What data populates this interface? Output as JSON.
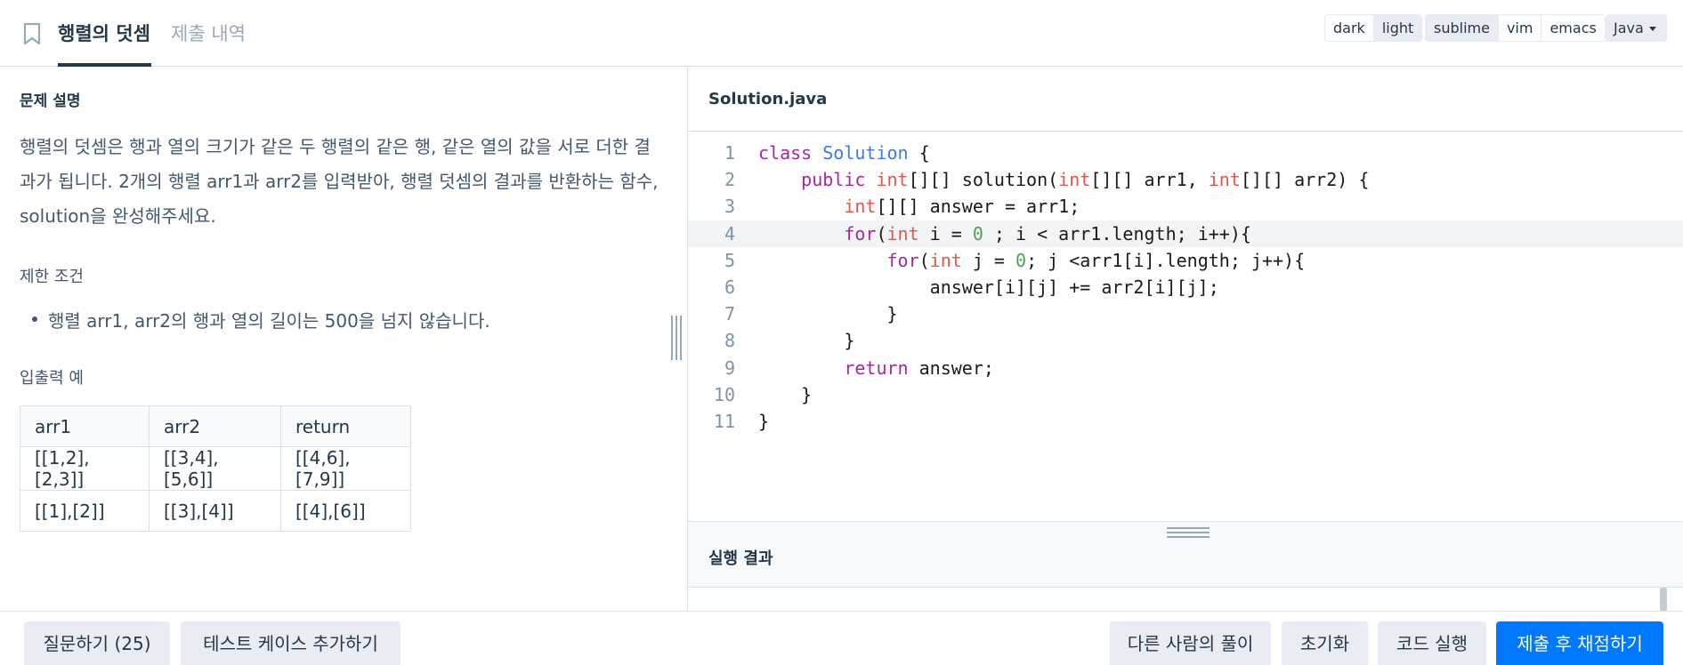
{
  "header": {
    "tabs": [
      {
        "label": "행렬의 덧셈",
        "active": true
      },
      {
        "label": "제출 내역",
        "active": false
      }
    ],
    "theme_options": [
      "dark",
      "light"
    ],
    "theme_selected": "light",
    "keymap_options": [
      "sublime",
      "vim",
      "emacs"
    ],
    "keymap_selected": "sublime",
    "language": "Java"
  },
  "problem": {
    "section_title": "문제 설명",
    "description": "행렬의 덧셈은 행과 열의 크기가 같은 두 행렬의 같은 행, 같은 열의 값을 서로 더한 결과가 됩니다. 2개의 행렬 arr1과 arr2를 입력받아, 행렬 덧셈의 결과를 반환하는 함수, solution을 완성해주세요.",
    "constraints_title": "제한 조건",
    "constraints": [
      "행렬 arr1, arr2의 행과 열의 길이는 500을 넘지 않습니다."
    ],
    "examples_title": "입출력 예",
    "examples_table": {
      "headers": [
        "arr1",
        "arr2",
        "return"
      ],
      "rows": [
        [
          "[[1,2],[2,3]]",
          "[[3,4],[5,6]]",
          "[[4,6],[7,9]]"
        ],
        [
          "[[1],[2]]",
          "[[3],[4]]",
          "[[4],[6]]"
        ]
      ]
    }
  },
  "editor": {
    "file_name": "Solution.java",
    "highlighted_line": 4,
    "lines": [
      {
        "n": "1",
        "code": "class Solution {"
      },
      {
        "n": "2",
        "code": "    public int[][] solution(int[][] arr1, int[][] arr2) {"
      },
      {
        "n": "3",
        "code": "        int[][] answer = arr1;"
      },
      {
        "n": "4",
        "code": "        for(int i = 0 ; i < arr1.length; i++){"
      },
      {
        "n": "5",
        "code": "            for(int j = 0; j <arr1[i].length; j++){"
      },
      {
        "n": "6",
        "code": "                answer[i][j] += arr2[i][j];"
      },
      {
        "n": "7",
        "code": "            }"
      },
      {
        "n": "8",
        "code": "        }"
      },
      {
        "n": "9",
        "code": "        return answer;"
      },
      {
        "n": "10",
        "code": "    }"
      },
      {
        "n": "11",
        "code": "}"
      }
    ],
    "result_title": "실행 결과"
  },
  "footer": {
    "question_button": "질문하기 (25)",
    "add_testcase_button": "테스트 케이스 추가하기",
    "others_solution_button": "다른 사람의 풀이",
    "reset_button": "초기화",
    "run_button": "코드 실행",
    "submit_button": "제출 후 채점하기"
  },
  "colors": {
    "primary": "#0078ff",
    "text": "#263747",
    "muted": "#98a8b9",
    "keyword": "#a626a4",
    "type": "#e45649",
    "class_name": "#4078f2",
    "number": "#50a14f"
  }
}
